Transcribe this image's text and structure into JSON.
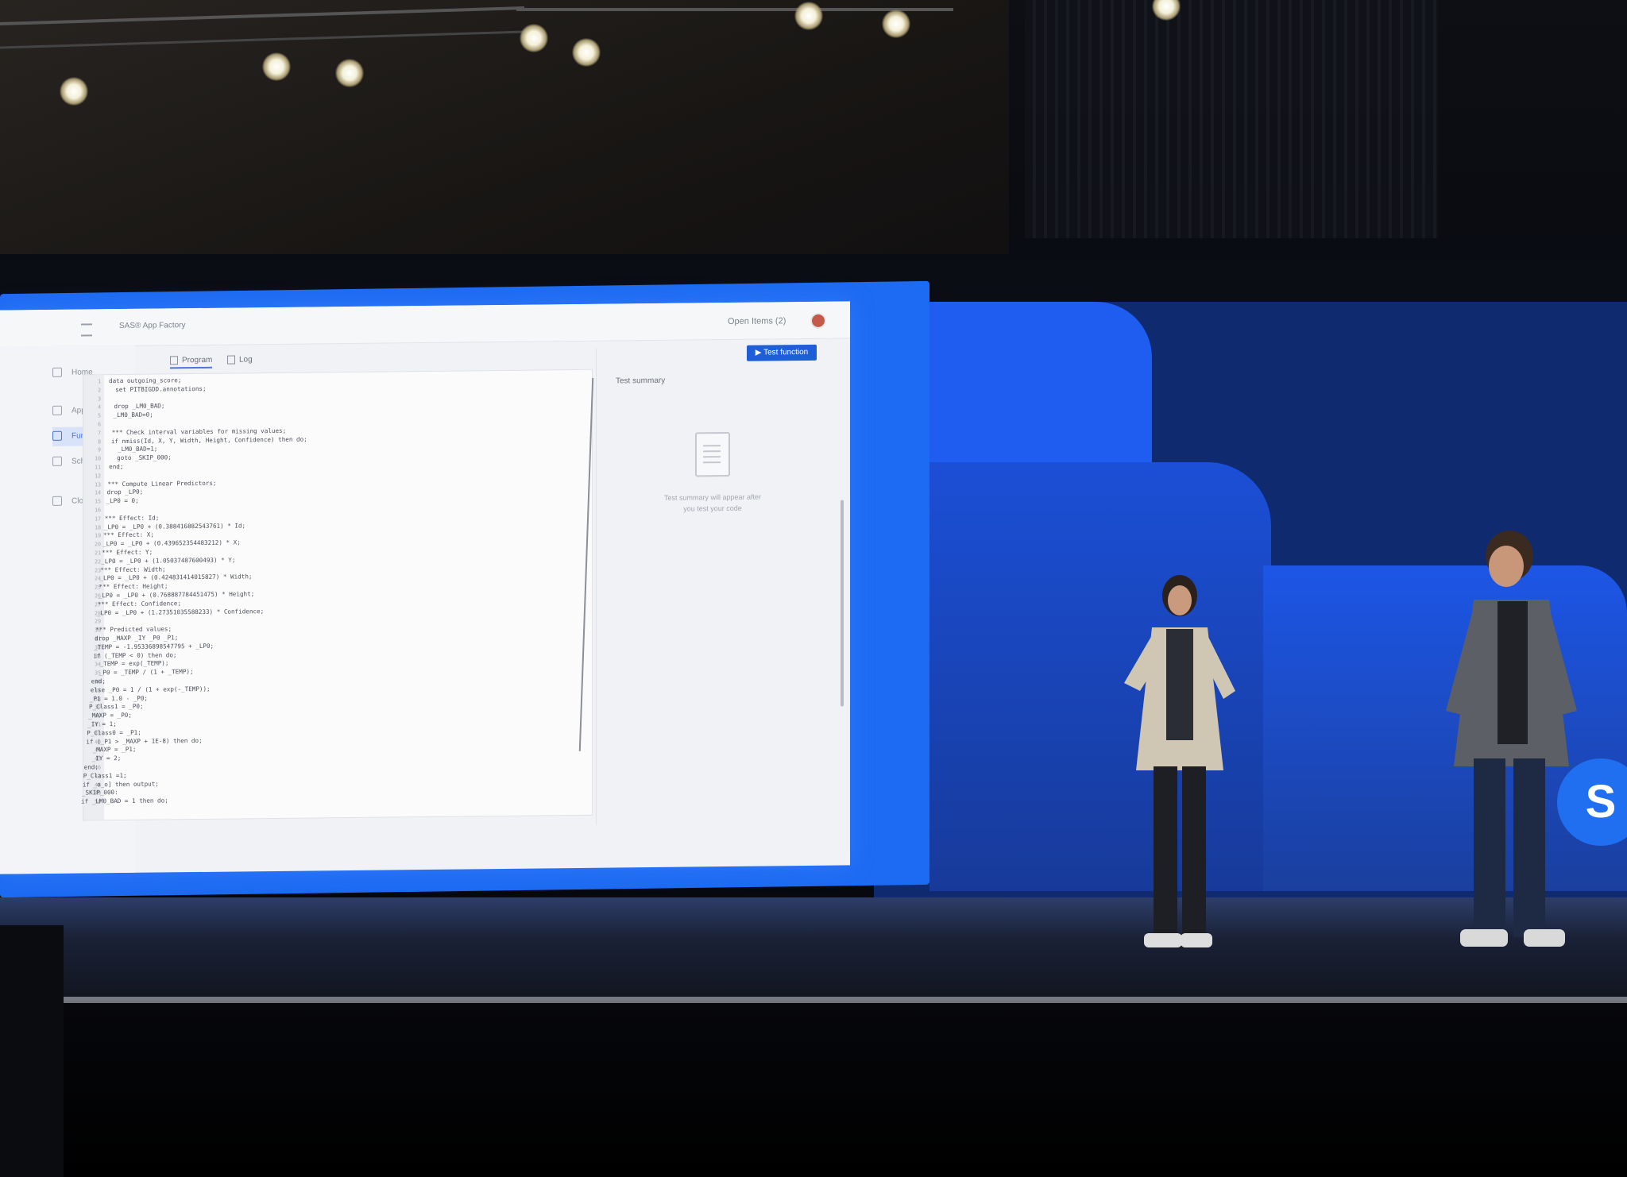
{
  "screen": {
    "topbar": {
      "app_title": "SAS® App Factory",
      "open_items": "Open Items (2)"
    },
    "sidebar": {
      "items": [
        {
          "label": "Home",
          "icon": "home-icon"
        },
        {
          "label": "Applications",
          "icon": "applications-icon"
        },
        {
          "label": "Functions",
          "icon": "functions-icon",
          "active": true
        },
        {
          "label": "Schemas",
          "icon": "schemas-icon"
        },
        {
          "label": "Cloud Drive",
          "icon": "cloud-icon"
        }
      ]
    },
    "editor": {
      "tabs": [
        {
          "label": "Program",
          "active": true
        },
        {
          "label": "Log"
        }
      ],
      "code": [
        "data outgoing_score;",
        "  set PITBIGDD.annotations;",
        "",
        "  drop _LM0_BAD;",
        "  _LM0_BAD=0;",
        "",
        "  *** Check interval variables for missing values;",
        "  if nmiss(Id, X, Y, Width, Height, Confidence) then do;",
        "    _LM0_BAD=1;",
        "    goto _SKIP_000;",
        "  end;",
        "",
        "  *** Compute Linear Predictors;",
        "  drop _LP0;",
        "  _LP0 = 0;",
        "",
        "  *** Effect: Id;",
        "  _LP0 = _LP0 + (0.388416882543761) * Id;",
        "  *** Effect: X;",
        "  _LP0 = _LP0 + (0.439652354483212) * X;",
        "  *** Effect: Y;",
        "  _LP0 = _LP0 + (1.05037487600493) * Y;",
        "  *** Effect: Width;",
        "  _LP0 = _LP0 + (0.424831414015827) * Width;",
        "  *** Effect: Height;",
        "  _LP0 = _LP0 + (0.768887784451475) * Height;",
        "  *** Effect: Confidence;",
        "  _LP0 = _LP0 + (1.27351035588233) * Confidence;",
        "",
        "  *** Predicted values;",
        "  drop _MAXP _IY _P0 _P1;",
        "  _TEMP = -1.95336898547795 + _LP0;",
        "  if (_TEMP < 0) then do;",
        "    _TEMP = exp(_TEMP);",
        "    _P0 = _TEMP / (1 + _TEMP);",
        "  end;",
        "  else _P0 = 1 / (1 + exp(-_TEMP));",
        "  _P1 = 1.0 - _P0;",
        "  P_Class1 = _P0;",
        "  _MAXP = _P0;",
        "  _IY = 1;",
        "  P_Class0 = _P1;",
        "  if (_P1 > _MAXP + 1E-8) then do;",
        "    _MAXP = _P1;",
        "    _IY = 2;",
        "  end;",
        "  P_Class1 =1;",
        "  if _o_o] then output;",
        "  _SKIP_000:",
        "  if _LM0_BAD = 1 then do;"
      ]
    },
    "test_panel": {
      "title": "Test summary",
      "button_label": "Test function",
      "empty_message": "Test summary will appear after you test your code"
    }
  },
  "stage": {
    "logo_letter": "S"
  }
}
